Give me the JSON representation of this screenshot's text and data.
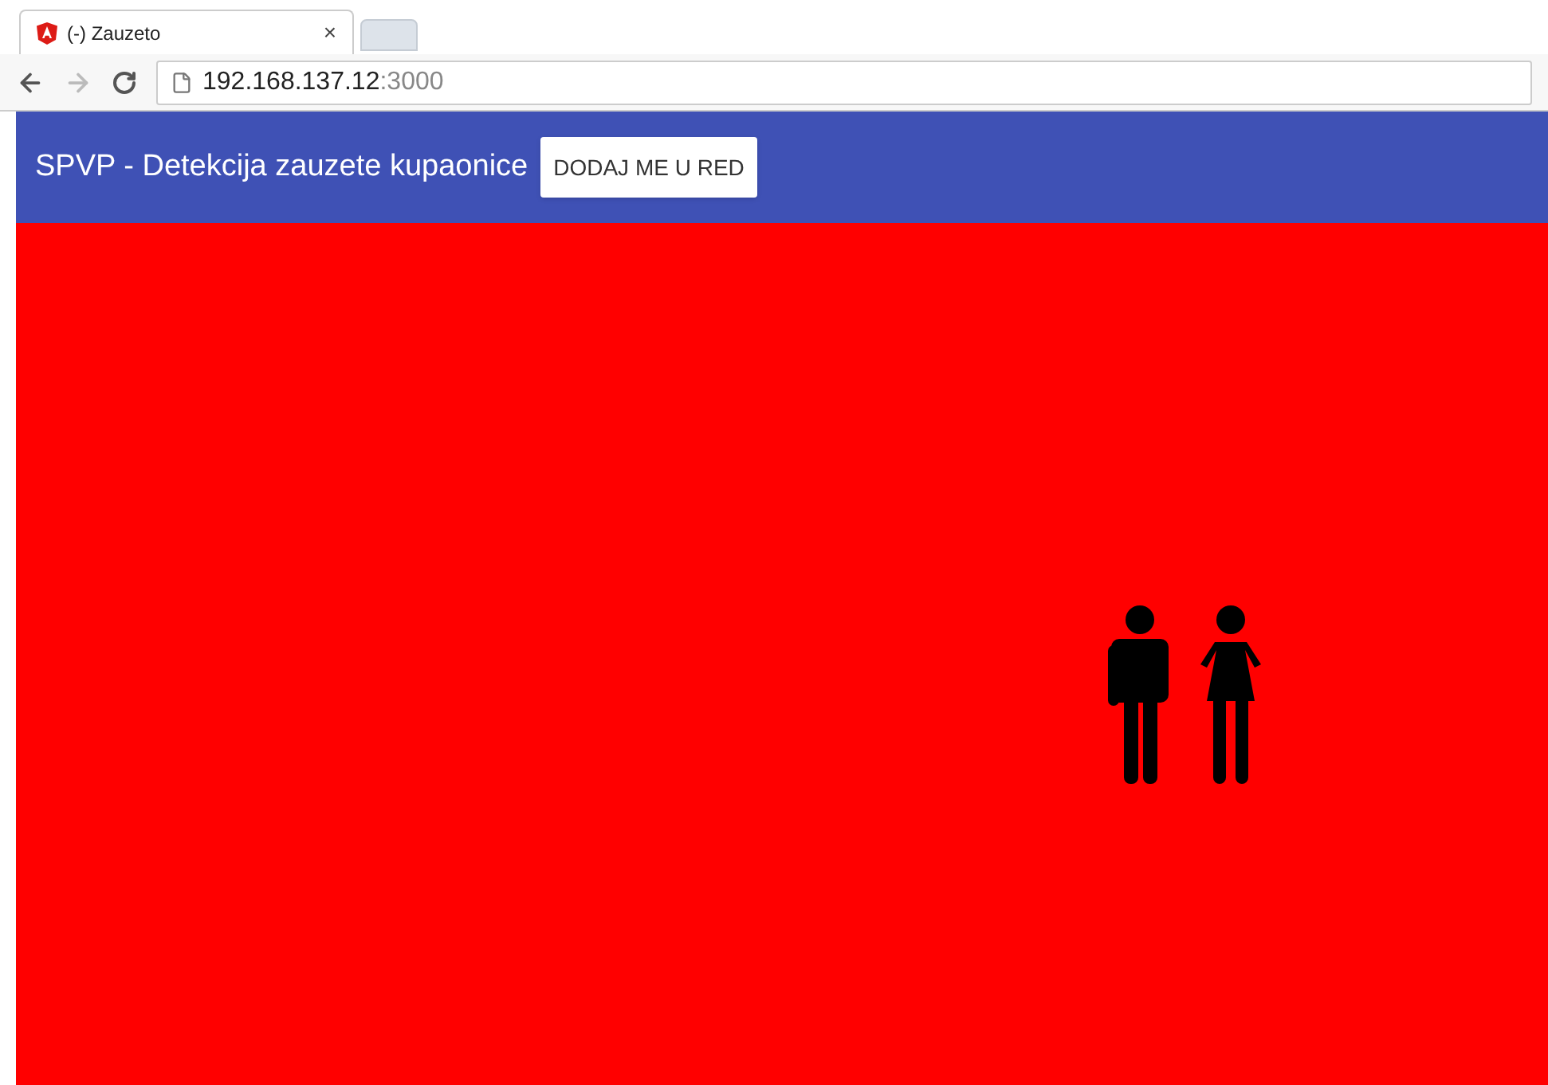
{
  "browser": {
    "tab_title": "(-) Zauzeto",
    "tab_close": "×",
    "url_host": "192.168.137.12",
    "url_port": ":3000"
  },
  "app_bar": {
    "title": "SPVP - Detekcija zauzete kupaonice",
    "button": "DODAJ ME U RED"
  },
  "status": {
    "occupied": true
  }
}
